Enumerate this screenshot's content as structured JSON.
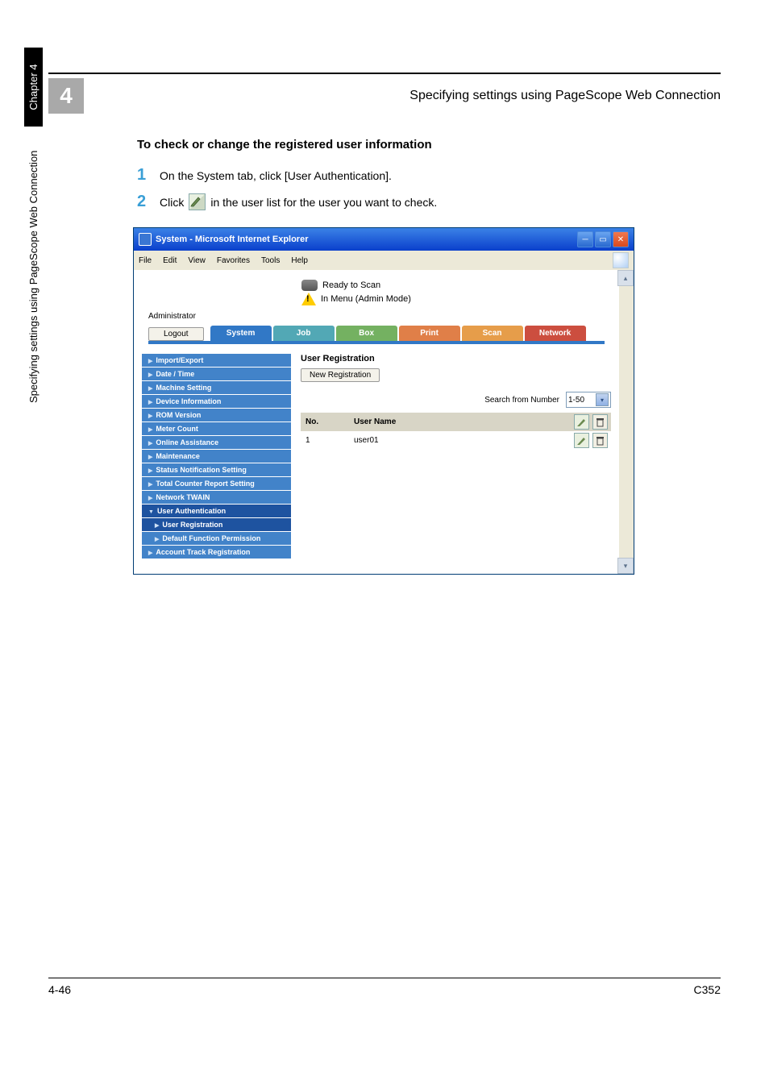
{
  "header": {
    "chapter_number": "4",
    "title": "Specifying settings using PageScope Web Connection"
  },
  "section_heading": "To check or change the registered user information",
  "steps": [
    {
      "num": "1",
      "text": "On the System tab, click [User Authentication]."
    },
    {
      "num": "2",
      "text_before": "Click ",
      "text_after": " in the user list for the user you want to check."
    }
  ],
  "window": {
    "title": "System - Microsoft Internet Explorer",
    "menu": [
      "File",
      "Edit",
      "View",
      "Favorites",
      "Tools",
      "Help"
    ],
    "status_line1": "Ready to Scan",
    "status_line2": "In Menu (Admin Mode)",
    "admin_label": "Administrator",
    "logout_label": "Logout",
    "tabs": {
      "system": "System",
      "job": "Job",
      "box": "Box",
      "print": "Print",
      "scan": "Scan",
      "network": "Network"
    },
    "sidebar": [
      "Import/Export",
      "Date / Time",
      "Machine Setting",
      "Device Information",
      "ROM Version",
      "Meter Count",
      "Online Assistance",
      "Maintenance",
      "Status Notification Setting",
      "Total Counter Report Setting",
      "Network TWAIN",
      "User Authentication",
      "User Registration",
      "Default Function Permission",
      "Account Track Registration"
    ],
    "main": {
      "heading": "User Registration",
      "newreg_label": "New Registration",
      "search_label": "Search from Number",
      "search_value": "1-50",
      "col_no": "No.",
      "col_name": "User Name",
      "row1_no": "1",
      "row1_name": "user01"
    }
  },
  "side_text": {
    "long": "Specifying settings using PageScope Web Connection",
    "chap": "Chapter 4"
  },
  "footer": {
    "page": "4-46",
    "model": "C352"
  }
}
